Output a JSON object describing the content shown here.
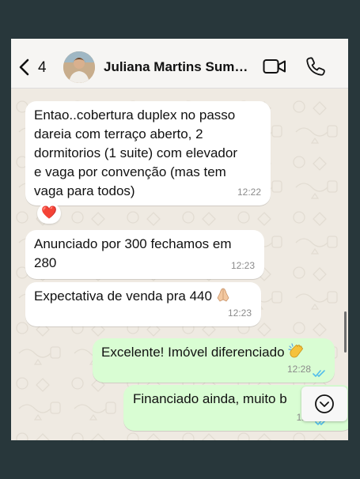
{
  "header": {
    "back_count": "4",
    "contact_name": "Juliana Martins Sum…",
    "icons": {
      "back": "chevron-left-icon",
      "video": "video-call-icon",
      "call": "phone-call-icon"
    }
  },
  "messages": [
    {
      "direction": "incoming",
      "text": "Entao..cobertura duplex no passo\ndareia com terraço aberto, 2\ndormitorios (1 suite) com elevador\ne vaga por convenção (mas tem\nvaga para todos)",
      "time": "12:22",
      "reaction": "❤️"
    },
    {
      "direction": "incoming",
      "text": "Anunciado por 300 fechamos em\n280",
      "time": "12:23"
    },
    {
      "direction": "incoming",
      "text": "Expectativa de venda pra 440",
      "emoji": "folded-hands-emoji",
      "time": "12:23"
    },
    {
      "direction": "outgoing",
      "text": "Excelente! Imóvel diferenciado",
      "emoji": "clapping-hands-emoji",
      "time": "12:28",
      "status": "read"
    },
    {
      "direction": "outgoing",
      "text": "Financiado ainda, muito b",
      "time": "12:2",
      "status": "read"
    }
  ],
  "colors": {
    "background": "#28373b",
    "chat_wallpaper": "#efeae2",
    "incoming_bubble": "#ffffff",
    "outgoing_bubble": "#d9fdd3",
    "read_ticks": "#53bdeb"
  },
  "scroll_button": {
    "icon": "chevron-down-circle-icon"
  }
}
